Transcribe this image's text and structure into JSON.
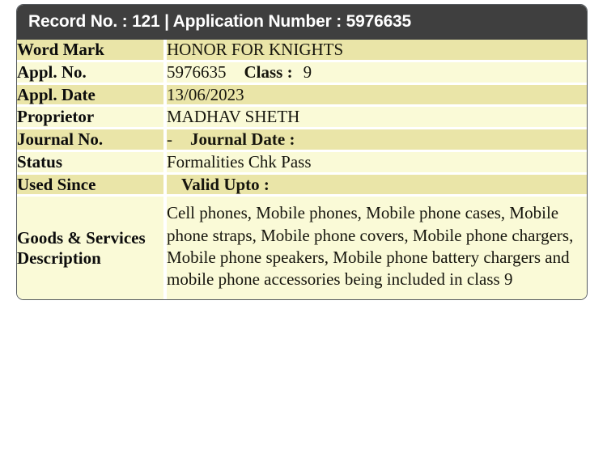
{
  "header": {
    "title": "Record No. : 121 | Application Number : 5976635",
    "record_no_label": "Record No. :",
    "record_no": "121",
    "application_number_label": "Application Number :",
    "application_number": "5976635"
  },
  "colors": {
    "header_bg": "#3f3f3f",
    "header_text": "#ffffff",
    "row_dark": "#eae5a8",
    "row_light": "#fafad7",
    "border": "#555a5e",
    "text": "#16150d"
  },
  "rows": {
    "word_mark": {
      "label": "Word Mark",
      "value": "HONOR FOR KNIGHTS"
    },
    "appl_no": {
      "label": "Appl. No.",
      "value": "5976635",
      "class_label": "Class :",
      "class_value": "9"
    },
    "appl_date": {
      "label": "Appl. Date",
      "value": "13/06/2023"
    },
    "proprietor": {
      "label": "Proprietor",
      "value": "MADHAV SHETH"
    },
    "journal_no": {
      "label": "Journal No.",
      "value": "-",
      "journal_date_label": "Journal Date :",
      "journal_date_value": ""
    },
    "status": {
      "label": "Status",
      "value": "Formalities Chk Pass"
    },
    "used_since": {
      "label": "Used Since",
      "value": "",
      "valid_upto_label": "Valid Upto :",
      "valid_upto_value": ""
    },
    "goods_services": {
      "label": "Goods & Services Description",
      "value": "Cell phones, Mobile phones, Mobile phone cases, Mobile phone straps, Mobile phone covers, Mobile phone chargers, Mobile phone speakers, Mobile phone battery chargers and mobile phone accessories being included in class 9"
    }
  }
}
